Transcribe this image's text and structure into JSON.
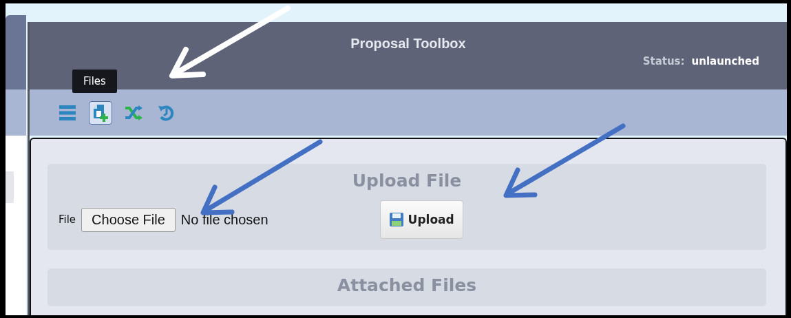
{
  "header": {
    "title": "Proposal Toolbox",
    "status_label": "Status:",
    "status_value": "unlaunched"
  },
  "toolbar": [
    {
      "kind": "menu",
      "selected": false
    },
    {
      "kind": "files",
      "selected": true
    },
    {
      "kind": "shuffle",
      "selected": false
    },
    {
      "kind": "history",
      "selected": false
    }
  ],
  "tooltip": "Files",
  "upload_section": {
    "title": "Upload File",
    "file_label": "File",
    "choose_button": "Choose File",
    "file_status": "No file chosen",
    "upload_button": "Upload"
  },
  "attached_section": {
    "title": "Attached Files"
  }
}
